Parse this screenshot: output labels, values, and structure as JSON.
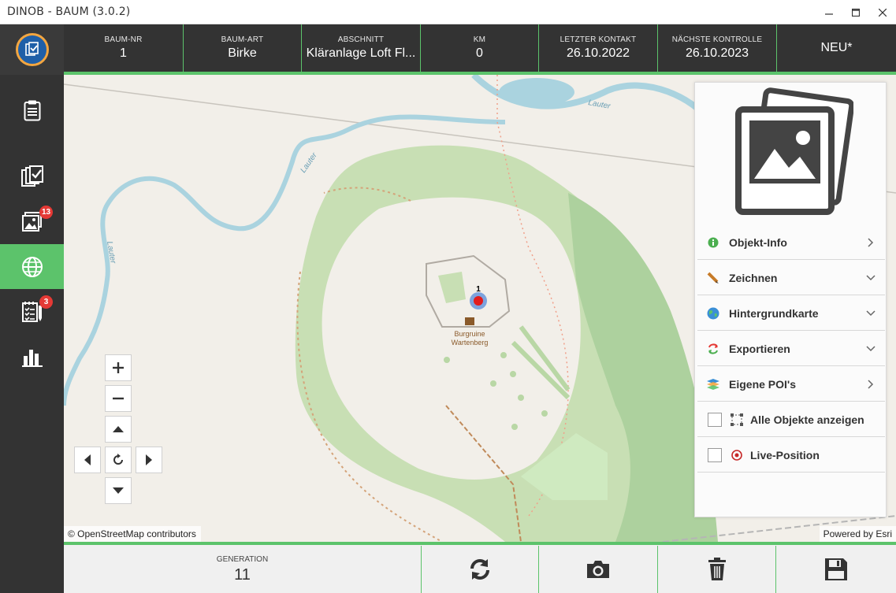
{
  "window": {
    "title": "DINOB - BAUM (3.0.2)",
    "buttons": [
      "minimize-icon",
      "maximize-icon",
      "close-icon"
    ]
  },
  "sidebar": {
    "items": [
      {
        "name": "clipboard-icon",
        "badge": null,
        "active": false
      },
      {
        "name": "checklist-stack-icon",
        "badge": null,
        "active": false
      },
      {
        "name": "photos-icon",
        "badge": "13",
        "active": false
      },
      {
        "name": "globe-icon",
        "badge": null,
        "active": true
      },
      {
        "name": "task-list-icon",
        "badge": "3",
        "active": false
      },
      {
        "name": "bar-chart-icon",
        "badge": null,
        "active": false
      }
    ]
  },
  "header": {
    "baum_nr": {
      "label": "BAUM-NR",
      "value": "1"
    },
    "baum_art": {
      "label": "BAUM-ART",
      "value": "Birke"
    },
    "abschnitt": {
      "label": "ABSCHNITT",
      "value": "Kläranlage Loft  Fl..."
    },
    "km": {
      "label": "KM",
      "value": "0"
    },
    "letzter_kontakt": {
      "label": "LETZTER KONTAKT",
      "value": "26.10.2022"
    },
    "naechste_kontrolle": {
      "label": "NÄCHSTE KONTROLLE",
      "value": "26.10.2023"
    },
    "status": "NEU*"
  },
  "map": {
    "labels": {
      "river1": "Lauter",
      "river2": "Lauter",
      "river3": "Lauter",
      "poi_name_line1": "Burgruine",
      "poi_name_line2": "Wartenberg",
      "marker_number": "1"
    },
    "attribution": "© OpenStreetMap contributors",
    "powered_by": "Powered by Esri"
  },
  "panel": {
    "items": [
      {
        "label": "Objekt-Info",
        "icon": "info-icon",
        "chevron": "right"
      },
      {
        "label": "Zeichnen",
        "icon": "pencil-icon",
        "chevron": "down"
      },
      {
        "label": "Hintergrundkarte",
        "icon": "earth-icon",
        "chevron": "down"
      },
      {
        "label": "Exportieren",
        "icon": "export-arrows-icon",
        "chevron": "down"
      },
      {
        "label": "Eigene POI's",
        "icon": "layers-icon",
        "chevron": "right"
      },
      {
        "label": "Alle Objekte anzeigen",
        "icon": "select-all-icon",
        "checked": false
      },
      {
        "label": "Live-Position",
        "icon": "target-icon",
        "checked": false
      }
    ]
  },
  "footer": {
    "generation": {
      "label": "GENERATION",
      "value": "11"
    },
    "buttons": [
      "refresh-icon",
      "camera-icon",
      "trash-icon",
      "save-icon"
    ]
  },
  "colors": {
    "accent": "#5cc36b",
    "dark": "#333333",
    "badge": "#e53935",
    "river": "#aad3df",
    "forest": "#add19e"
  }
}
